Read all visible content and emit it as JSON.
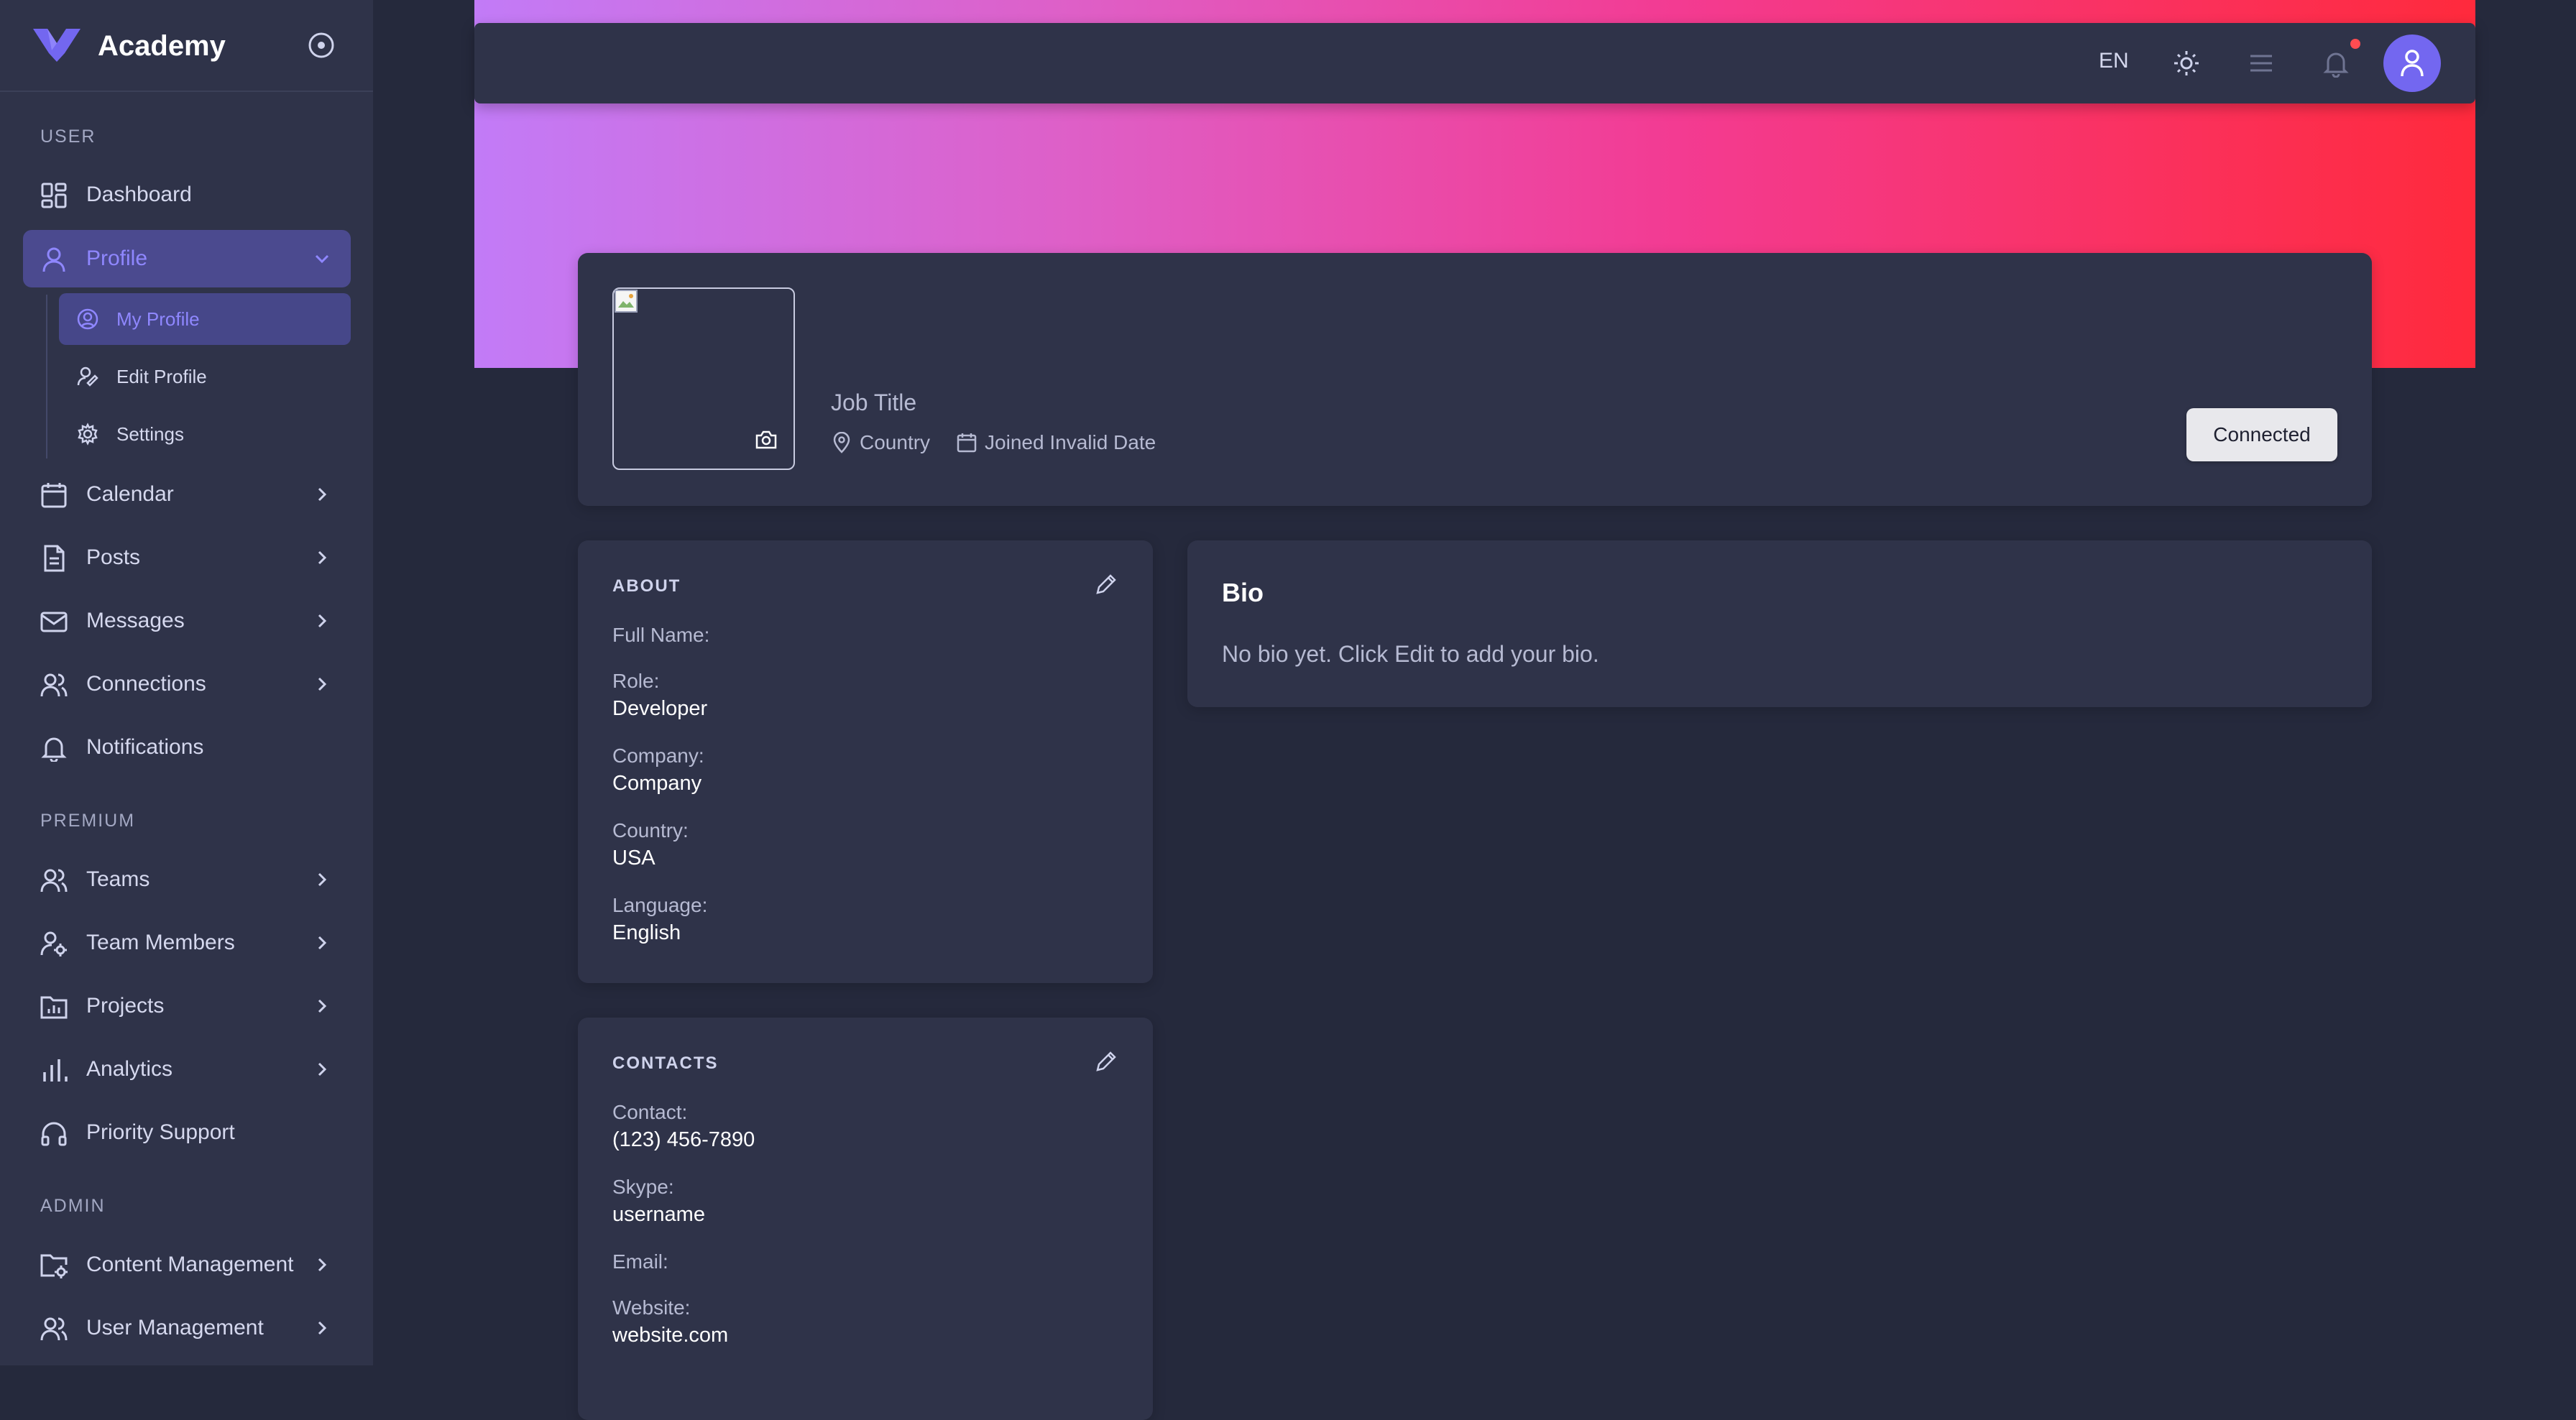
{
  "brand": {
    "name": "Academy"
  },
  "sidebar": {
    "sections": {
      "user": "USER",
      "premium": "PREMIUM",
      "admin": "ADMIN"
    },
    "items": [
      {
        "label": "Dashboard",
        "icon": "dashboard-icon"
      },
      {
        "label": "Profile",
        "icon": "user-icon"
      },
      {
        "label": "Calendar",
        "icon": "calendar-icon"
      },
      {
        "label": "Posts",
        "icon": "document-icon"
      },
      {
        "label": "Messages",
        "icon": "mail-icon"
      },
      {
        "label": "Connections",
        "icon": "users-icon"
      },
      {
        "label": "Notifications",
        "icon": "bell-icon"
      },
      {
        "label": "Teams",
        "icon": "users-icon"
      },
      {
        "label": "Team Members",
        "icon": "user-cog-icon"
      },
      {
        "label": "Projects",
        "icon": "chart-folder-icon"
      },
      {
        "label": "Analytics",
        "icon": "bar-chart-icon"
      },
      {
        "label": "Priority Support",
        "icon": "headphones-icon"
      },
      {
        "label": "Content Management",
        "icon": "folder-cog-icon"
      },
      {
        "label": "User Management",
        "icon": "users-icon"
      }
    ],
    "profile_sub": [
      {
        "label": "My Profile",
        "icon": "user-circle-icon"
      },
      {
        "label": "Edit Profile",
        "icon": "user-edit-icon"
      },
      {
        "label": "Settings",
        "icon": "gear-icon"
      }
    ]
  },
  "topbar": {
    "language": "EN"
  },
  "profile": {
    "job_title": "Job Title",
    "country": "Country",
    "joined": "Joined Invalid Date",
    "connected_label": "Connected"
  },
  "about": {
    "heading": "ABOUT",
    "fields": [
      {
        "label": "Full Name:",
        "value": ""
      },
      {
        "label": "Role:",
        "value": "Developer"
      },
      {
        "label": "Company:",
        "value": "Company"
      },
      {
        "label": "Country:",
        "value": "USA"
      },
      {
        "label": "Language:",
        "value": "English"
      }
    ]
  },
  "contacts": {
    "heading": "CONTACTS",
    "fields": [
      {
        "label": "Contact:",
        "value": "(123) 456-7890"
      },
      {
        "label": "Skype:",
        "value": "username"
      },
      {
        "label": "Email:",
        "value": ""
      },
      {
        "label": "Website:",
        "value": "website.com"
      }
    ]
  },
  "bio": {
    "title": "Bio",
    "text": "No bio yet. Click Edit to add your bio."
  },
  "colors": {
    "primary": "#7367f0",
    "sidebar_bg": "#2f3349",
    "page_bg": "#25293c",
    "active_bg": "#4b4a8f",
    "active_text": "#8f87ff",
    "notification_dot": "#ff4c51"
  }
}
